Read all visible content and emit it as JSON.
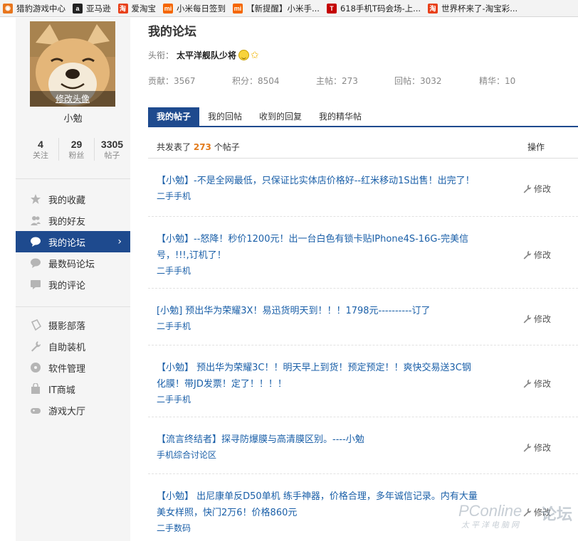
{
  "bookmarks": [
    {
      "label": "猎豹游戏中心",
      "icon": "cheetah-icon",
      "color": "#e8761e",
      "glyph": "◉"
    },
    {
      "label": "亚马逊",
      "icon": "amazon-icon",
      "color": "#222222",
      "glyph": "a"
    },
    {
      "label": "爱淘宝",
      "icon": "taobao-icon",
      "color": "#e8401a",
      "glyph": "淘"
    },
    {
      "label": "小米每日签到",
      "icon": "mi-icon",
      "color": "#f56600",
      "glyph": "mi"
    },
    {
      "label": "【新提醒】小米手...",
      "icon": "mi-icon",
      "color": "#f56600",
      "glyph": "mi"
    },
    {
      "label": "618手机T码会场-上...",
      "icon": "tmall-icon",
      "color": "#c40000",
      "glyph": "T"
    },
    {
      "label": "世界杯来了-淘宝彩...",
      "icon": "taobao-icon",
      "color": "#e8401a",
      "glyph": "淘"
    }
  ],
  "sidebar": {
    "avatar_caption": "修改头像",
    "username": "小勉",
    "stats": [
      {
        "num": "4",
        "label": "关注"
      },
      {
        "num": "29",
        "label": "粉丝"
      },
      {
        "num": "3305",
        "label": "帖子"
      }
    ],
    "menu1": [
      {
        "label": "我的收藏",
        "icon": "star-icon",
        "active": false
      },
      {
        "label": "我的好友",
        "icon": "friends-icon",
        "active": false
      },
      {
        "label": "我的论坛",
        "icon": "forum-icon",
        "active": true
      },
      {
        "label": "最数码论坛",
        "icon": "digital-forum-icon",
        "active": false
      },
      {
        "label": "我的评论",
        "icon": "comment-icon",
        "active": false
      }
    ],
    "menu2": [
      {
        "label": "摄影部落",
        "icon": "photography-icon"
      },
      {
        "label": "自助装机",
        "icon": "wrench-icon"
      },
      {
        "label": "软件管理",
        "icon": "disc-icon"
      },
      {
        "label": "IT商城",
        "icon": "shopping-bag-icon"
      },
      {
        "label": "游戏大厅",
        "icon": "gamepad-icon"
      }
    ]
  },
  "main": {
    "title": "我的论坛",
    "rank_label": "头衔：",
    "rank_value": "太平洋舰队少将",
    "meta": [
      {
        "text": "贡献：3567"
      },
      {
        "text": "积分：8504"
      },
      {
        "text": "主帖：273"
      },
      {
        "text": "回帖：3032"
      },
      {
        "text": "精华：10"
      }
    ],
    "tabs": [
      "我的帖子",
      "我的回帖",
      "收到的回复",
      "我的精华帖"
    ],
    "active_tab": 0,
    "list_header": {
      "prefix": "共发表了",
      "count": "273",
      "suffix": "个帖子",
      "action_col": "操作"
    },
    "posts": [
      {
        "title_lines": [
          "【小勉】-不是全网最低，只保证比实体店价格好--红米移动1S出售！出完了！"
        ],
        "board": "二手手机",
        "action": "修改"
      },
      {
        "title_lines": [
          "【小勉】--怒降！秒价1200元！出一台白色有锁卡贴IPhone4S-16G-完美信",
          "号，!!!,订机了！"
        ],
        "board": "二手手机",
        "action": "修改"
      },
      {
        "title_lines": [
          "[小勉] 预出华为荣耀3X！易迅货明天到！！！1798元----------订了"
        ],
        "board": "二手手机",
        "action": "修改"
      },
      {
        "title_lines": [
          "【小勉】 预出华为荣耀3C！！明天早上到货！预定预定！！爽快交易送3C钢",
          "化膜！带JD发票！定了！！！！"
        ],
        "board": "二手手机",
        "action": "修改"
      },
      {
        "title_lines": [
          "【流言终结者】探寻防爆膜与高清膜区别。----小勉"
        ],
        "board": "手机综合讨论区",
        "action": "修改"
      },
      {
        "title_lines": [
          "【小勉】 出尼康单反D50单机 练手神器，价格合理，多年诚信记录。内有大量",
          "美女样照，快门2万6！价格860元"
        ],
        "board": "二手数码",
        "action": "修改"
      }
    ]
  },
  "watermark": {
    "brand": "PConline",
    "forum": "论坛",
    "sub": "太平洋电脑网"
  },
  "colors": {
    "accent": "#1e4a8e",
    "link": "#1a5fa8",
    "count": "#e37b1c"
  }
}
